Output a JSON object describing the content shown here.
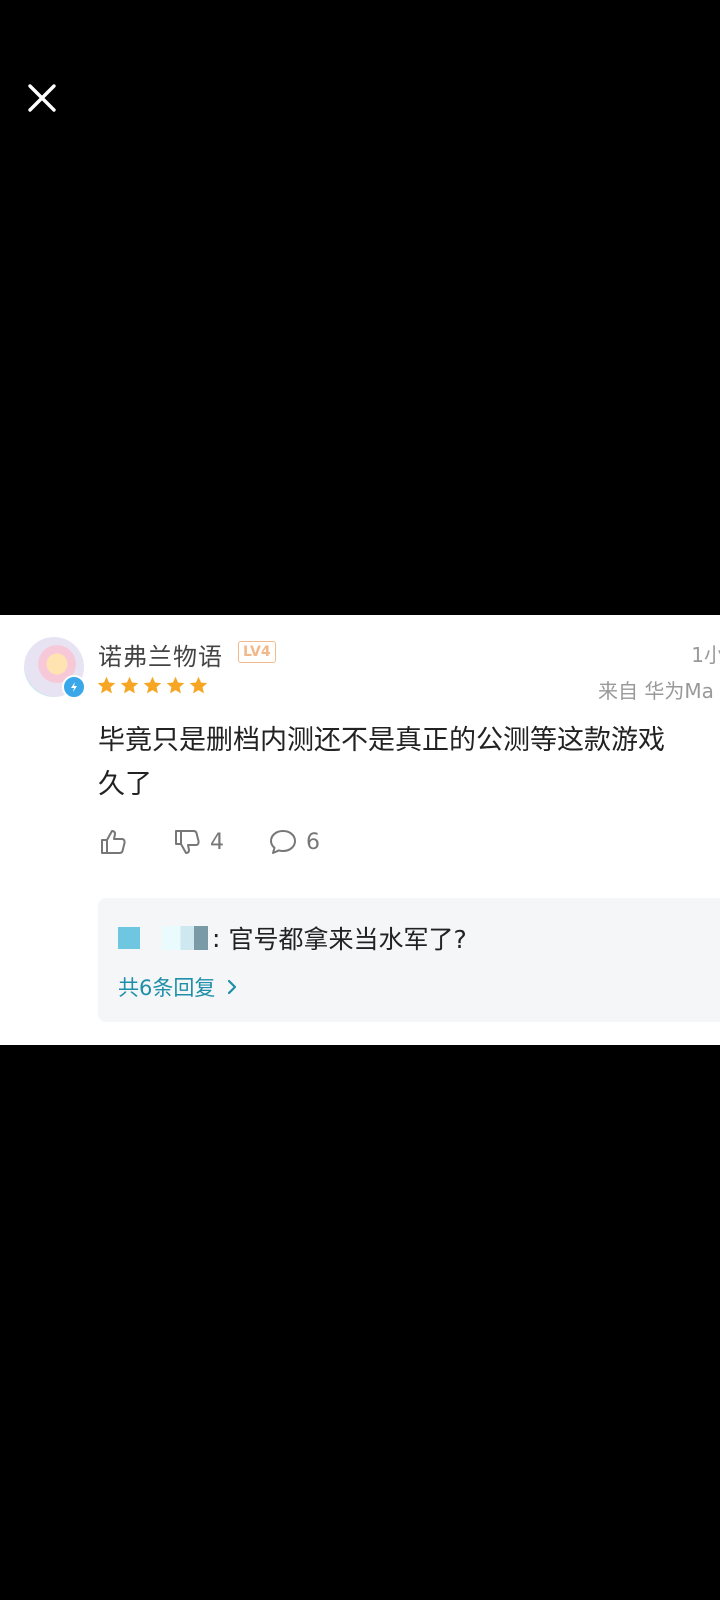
{
  "comment": {
    "username": "诺弗兰物语",
    "level_badge": "LV4",
    "time": "1小",
    "device": "来自 华为Ma",
    "rating": 5,
    "body": "毕竟只是删档内测还不是真正的公测等这款游戏\n久了",
    "dislike_count": "4",
    "reply_count": "6"
  },
  "reply_preview": {
    "separator": ":",
    "text": "官号都拿来当水军了?",
    "more_label": "共6条回复"
  },
  "colors": {
    "background": "#000000",
    "card": "#ffffff",
    "star": "#f6a623",
    "link": "#1e8ea9"
  }
}
